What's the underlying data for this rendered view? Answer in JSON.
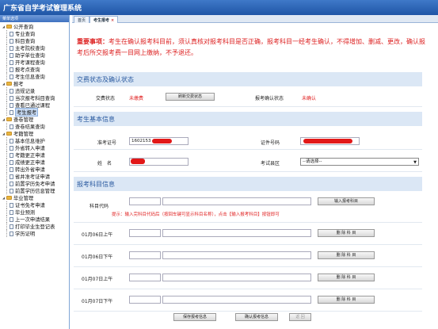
{
  "app": {
    "title": "广东省自学考试管理系统"
  },
  "sidebar": {
    "header": "菜单选项",
    "groups": [
      {
        "label": "公开查询",
        "items": [
          "专业查询",
          "科目查询",
          "主考院校查询",
          "助学单位查询",
          "开考课程查询",
          "报考点查询",
          "考生信息查询"
        ]
      },
      {
        "label": "报考",
        "items": [
          "违规记录",
          "当次报考科目查询",
          "查看已通过课程",
          "考生报考"
        ]
      },
      {
        "label": "查卷管理",
        "items": [
          "查卷结果查询"
        ]
      },
      {
        "label": "考籍管理",
        "items": [
          "基本信息维护",
          "外省转入申请",
          "考籍更正申请",
          "成绩更正申请",
          "转出外省申请",
          "省并准考证申请",
          "前置学历免考申请",
          "前置学历信息管理"
        ]
      },
      {
        "label": "毕业管理",
        "items": [
          "证书免考申请",
          "毕业预测",
          "上一次申请结果",
          "打印毕业生登记表",
          "学历证明"
        ]
      }
    ],
    "selected": "考生报考"
  },
  "tabs": [
    {
      "label": "首页"
    },
    {
      "label": "考生报考",
      "close": "×"
    }
  ],
  "notice": {
    "prefix": "重要事项：",
    "text": "考生在确认报考科目前，须认真核对报考科目是否正确，报考科目一经考生确认，不得增加、删减、更改，确认报考后所交报考费一目网上缴纳，不予退还。"
  },
  "payment": {
    "title": "交费状态及确认状态",
    "fee_status_label": "交费状态",
    "fee_status_value": "未缴费",
    "refresh_button": "刷新交费状态",
    "confirm_status_label": "报考确认状态",
    "confirm_status_value": "未确认"
  },
  "student": {
    "title": "考生基本信息",
    "exam_no_label": "准考证号",
    "exam_no_value": "1602153",
    "id_label": "证件号码",
    "name_label": "姓　名",
    "region_label": "考试县区",
    "region_placeholder": "--请选择--"
  },
  "subjects": {
    "title": "报考科目信息",
    "code_label": "科目代码",
    "input_button": "输入报考科目",
    "hint": "提示：输入完科目代码后（按回车键可显示科目名称），点击【输入报考科目】按钮即可",
    "slots": [
      {
        "label": "01月06日上午",
        "delete": "删 除 科 目"
      },
      {
        "label": "01月06日下午",
        "delete": "删 除 科 目"
      },
      {
        "label": "01月07日上午",
        "delete": "删 除 科 目"
      },
      {
        "label": "01月07日下午",
        "delete": "删 除 科 目"
      }
    ]
  },
  "footer": {
    "save": "保存报考信息",
    "confirm": "确认报考信息",
    "back": "返 回"
  },
  "colors": {
    "titlebar": "#2a62b4",
    "accent_red": "#e02020",
    "panel_head": "#dbe7f5"
  }
}
